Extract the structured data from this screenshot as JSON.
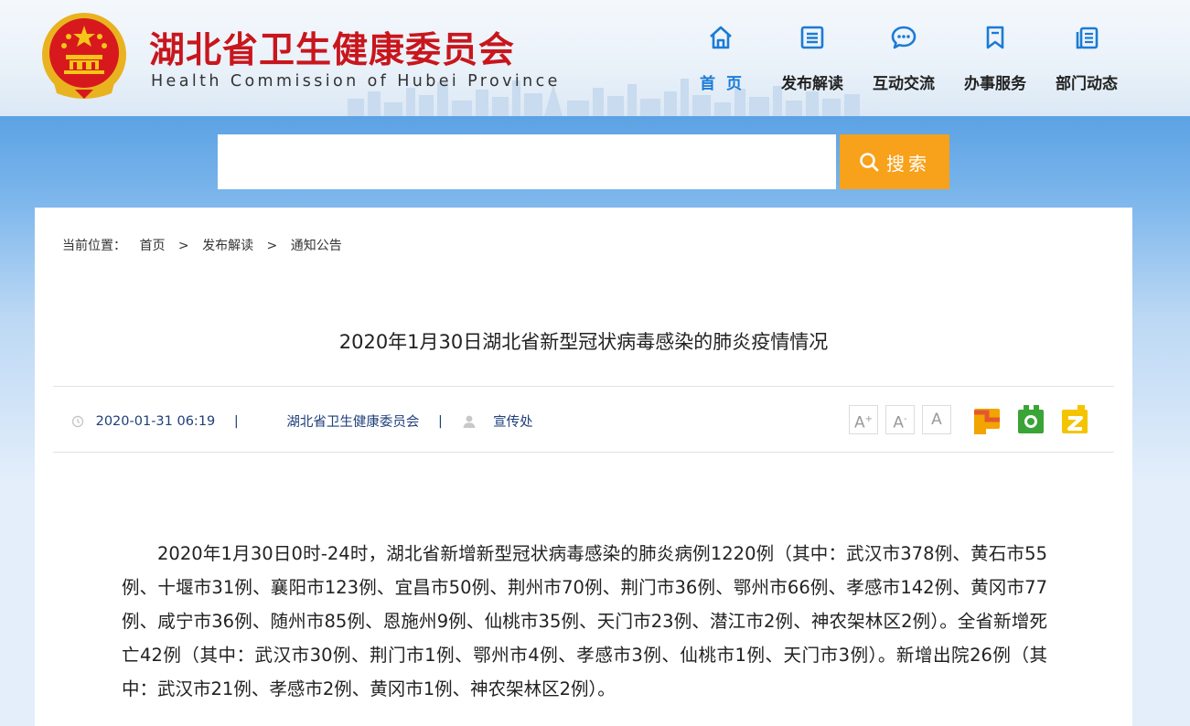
{
  "header": {
    "title": "湖北省卫生健康委员会",
    "subtitle": "Health Commission of Hubei Province",
    "colors": {
      "brand_red": "#c8161d",
      "nav_active": "#1a7bd6",
      "accent_orange": "#f8a11a"
    }
  },
  "nav": {
    "items": [
      {
        "label": "首页",
        "icon": "home-icon",
        "active": true
      },
      {
        "label": "发布解读",
        "icon": "document-list-icon",
        "active": false
      },
      {
        "label": "互动交流",
        "icon": "chat-bubble-icon",
        "active": false
      },
      {
        "label": "办事服务",
        "icon": "bookmark-icon",
        "active": false
      },
      {
        "label": "部门动态",
        "icon": "stacked-pages-icon",
        "active": false
      }
    ]
  },
  "search": {
    "placeholder": "",
    "button_label": "搜索",
    "button_icon": "search-icon"
  },
  "breadcrumb": {
    "prefix": "当前位置：",
    "items": [
      "首页",
      "发布解读",
      "通知公告"
    ],
    "separator": ">"
  },
  "article": {
    "title": "2020年1月30日湖北省新型冠状病毒感染的肺炎疫情情况",
    "meta": {
      "datetime": "2020-01-31 06:19",
      "source": "湖北省卫生健康委员会",
      "author": "宣传处",
      "divider": "|"
    },
    "font_size_buttons": [
      "A+",
      "A-",
      "A"
    ],
    "share_icons": [
      "weibo-icon",
      "wechat-icon",
      "qzone-icon"
    ],
    "body": "2020年1月30日0时-24时，湖北省新增新型冠状病毒感染的肺炎病例1220例（其中：武汉市378例、黄石市55例、十堰市31例、襄阳市123例、宜昌市50例、荆州市70例、荆门市36例、鄂州市66例、孝感市142例、黄冈市77例、咸宁市36例、随州市85例、恩施州9例、仙桃市35例、天门市23例、潜江市2例、神农架林区2例）。全省新增死亡42例（其中：武汉市30例、荆门市1例、鄂州市4例、孝感市3例、仙桃市1例、天门市3例）。新增出院26例（其中：武汉市21例、孝感市2例、黄冈市1例、神农架林区2例）。"
  }
}
